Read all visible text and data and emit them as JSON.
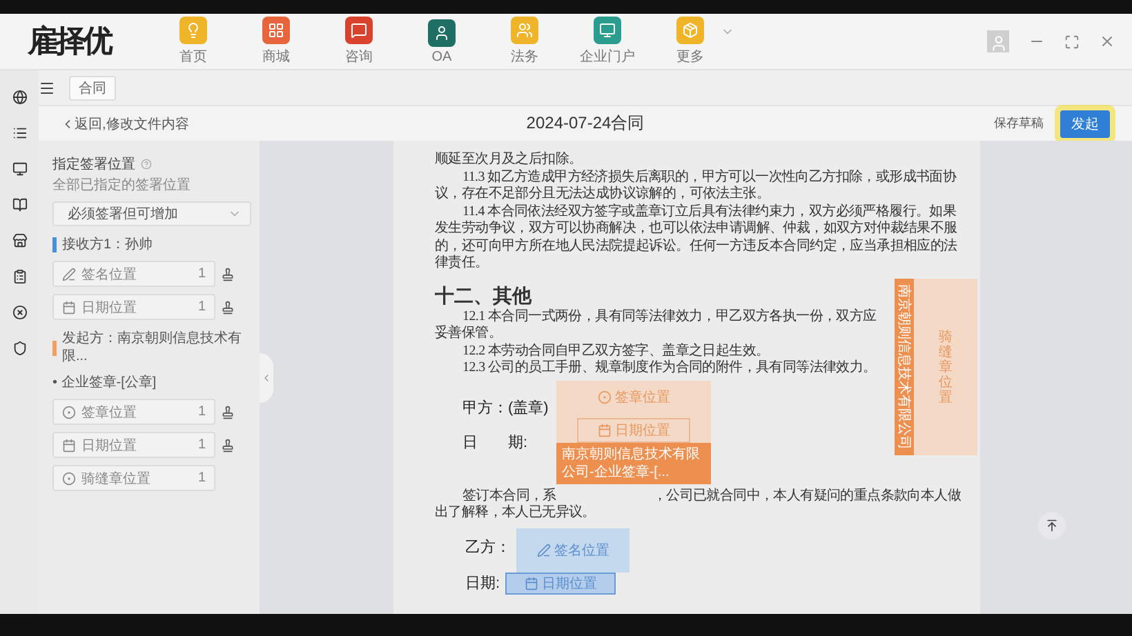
{
  "header": {
    "logo": "雇择优",
    "nav": [
      {
        "label": "首页",
        "color": "#f0b429"
      },
      {
        "label": "商城",
        "color": "#e8643c"
      },
      {
        "label": "咨询",
        "color": "#d9432e"
      },
      {
        "label": "OA",
        "color": "#1f6f64"
      },
      {
        "label": "法务",
        "color": "#f0b429"
      },
      {
        "label": "企业门户",
        "color": "#2a9d8f"
      },
      {
        "label": "更多",
        "color": "#f0b429"
      }
    ]
  },
  "toolbar": {
    "tag": "合同"
  },
  "action_bar": {
    "back": "返回,修改文件内容",
    "title": "2024-07-24合同",
    "save": "保存草稿",
    "submit": "发起"
  },
  "sidebar": {
    "title": "指定签署位置",
    "subtitle": "全部已指定的签署位置",
    "select": "必须签署但可增加",
    "parties": [
      {
        "label": "接收方1：孙帅",
        "color": "#4a90d9",
        "fields": [
          {
            "kind": "sign",
            "label": "签名位置",
            "count": "1",
            "locate": true
          },
          {
            "kind": "date",
            "label": "日期位置",
            "count": "1",
            "locate": true
          }
        ]
      },
      {
        "label": "发起方：南京朝则信息技术有限...",
        "color": "#f0a060",
        "group": "• 企业签章-[公章]",
        "fields": [
          {
            "kind": "seal",
            "label": "签章位置",
            "count": "1",
            "locate": true
          },
          {
            "kind": "date",
            "label": "日期位置",
            "count": "1",
            "locate": true
          },
          {
            "kind": "seal",
            "label": "骑缝章位置",
            "count": "1",
            "locate": false
          }
        ]
      }
    ]
  },
  "document": {
    "paragraphs": [
      {
        "kind": "continuation",
        "text": "顺延至次月及之后扣除。"
      },
      {
        "kind": "clause",
        "text": "11.3 如乙方造成甲方经济损失后离职的，甲方可以一次性向乙方扣除，或形成书面协议，存在不足部分且无法达成协议谅解的，可依法主张。"
      },
      {
        "kind": "clause",
        "text": "11.4 本合同依法经双方签字或盖章订立后具有法律约束力，双方必须严格履行。如果发生劳动争议，双方可以协商解决，也可以依法申请调解、仲裁，如双方对仲裁结果不服的，还可向甲方所在地人民法院提起诉讼。任何一方违反本合同约定，应当承担相应的法律责任。"
      }
    ],
    "heading": "十二、其他",
    "clauses": [
      "12.1 本合同一式两份，具有同等法律效力，甲乙双方各执一份，双方应妥善保管。",
      "12.2 本劳动合同自甲乙双方签字、盖章之日起生效。",
      "12.3 公司的员工手册、规章制度作为合同的附件，具有同等法律效力。"
    ],
    "party_a": {
      "label": "甲方：(盖章)",
      "date_label": "日　　期:",
      "seal": "签章位置",
      "date": "日期位置",
      "owner": "南京朝则信息技术有限公司-企业签章-[..."
    },
    "closing": {
      "before": "签订本合同，系",
      "after": "，公司已就合同中，本人有疑问的重点条款向本人做出了解释，本人已无异议。"
    },
    "party_b": {
      "label": "乙方：",
      "date_label": "日期:",
      "sign": "签名位置",
      "date": "日期位置"
    },
    "seam": {
      "owner": "南京朝则信息技术有限公司",
      "label": "骑缝章位置"
    }
  }
}
